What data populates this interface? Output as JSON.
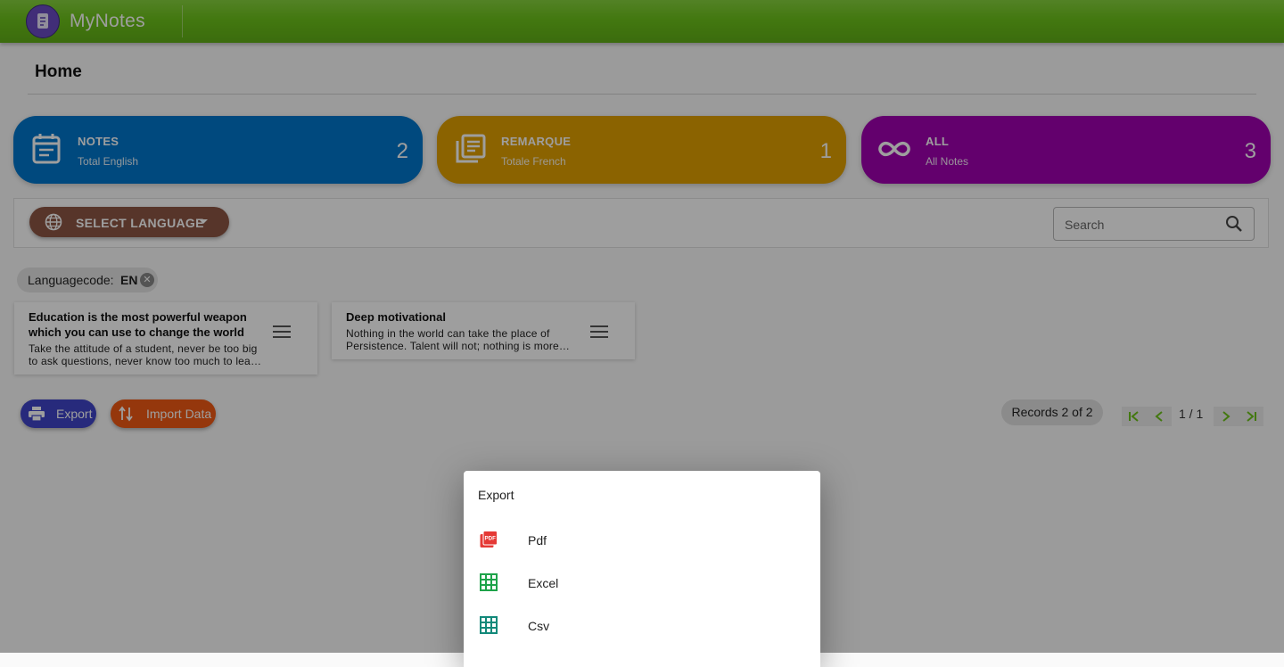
{
  "app": {
    "title": "MyNotes"
  },
  "page": {
    "title": "Home"
  },
  "stats": [
    {
      "label": "NOTES",
      "sub": "Total English",
      "count": "2",
      "color": "#0077cc",
      "icon": "calendar-note-icon"
    },
    {
      "label": "REMARQUE",
      "sub": "Totale French",
      "count": "1",
      "color": "#e0a000",
      "icon": "library-books-icon"
    },
    {
      "label": "ALL",
      "sub": "All Notes",
      "count": "3",
      "color": "#a000b0",
      "icon": "infinity-icon"
    }
  ],
  "filter": {
    "language_button": "SELECT LANGUAGE",
    "search_placeholder": "Search"
  },
  "chip": {
    "key": "Languagecode:",
    "value": "EN"
  },
  "notes": [
    {
      "title": "Education is the most powerful weapon which you can use to change the world",
      "body": "Take the attitude of a student, never be too big to ask questions, never know too much to learn something new."
    },
    {
      "title": "Deep motivational",
      "body": "Nothing in the world can take the place of Persistence. Talent will not; nothing is more common than unsuccessful men with talent."
    }
  ],
  "actions": {
    "export_label": "Export",
    "import_label": "Import Data"
  },
  "pagination": {
    "records": "Records 2 of 2",
    "page": "1 / 1"
  },
  "export_dialog": {
    "title": "Export",
    "items": [
      {
        "label": "Pdf",
        "icon": "pdf-icon",
        "color": "#e53935"
      },
      {
        "label": "Excel",
        "icon": "grid-table-icon",
        "color": "#1ea34a"
      },
      {
        "label": "Csv",
        "icon": "grid-table-icon",
        "color": "#12897a"
      }
    ]
  }
}
